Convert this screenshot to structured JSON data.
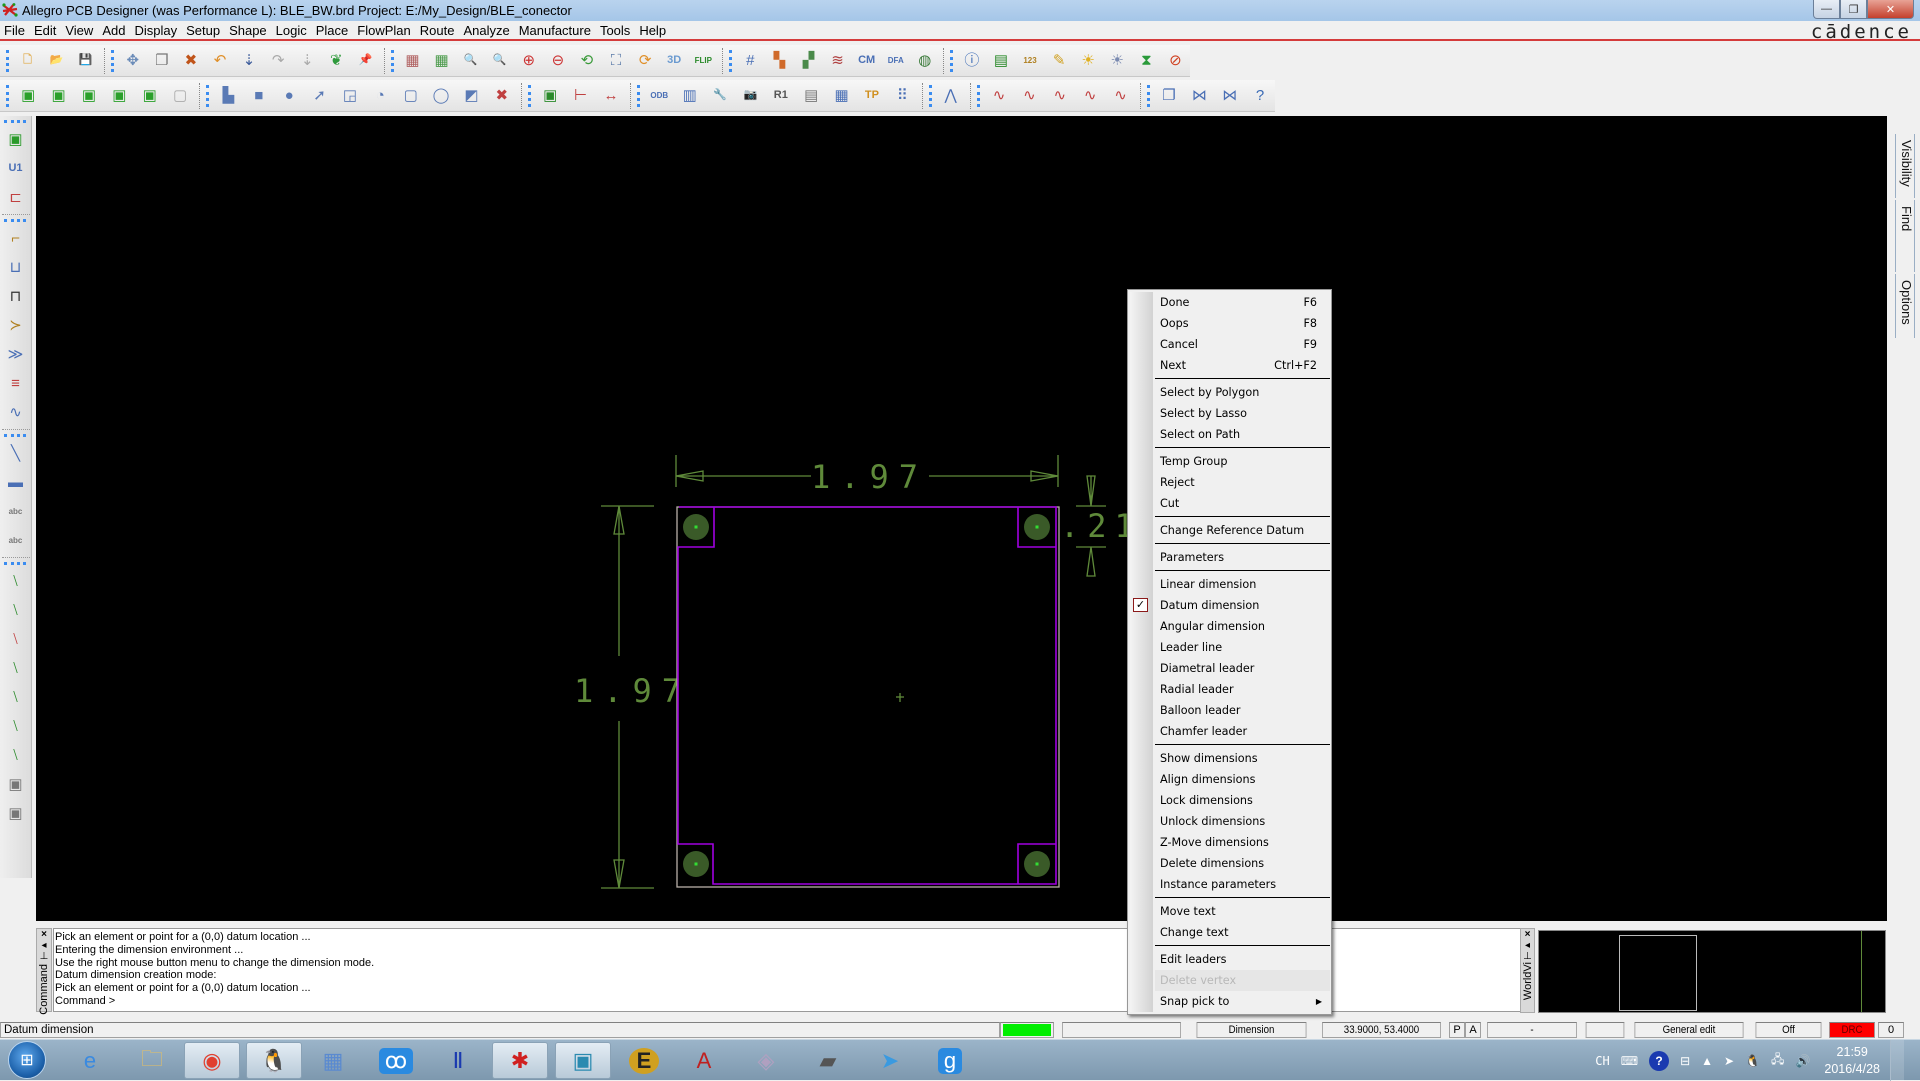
{
  "window": {
    "title": "Allegro PCB Designer (was Performance L): BLE_BW.brd  Project: E:/My_Design/BLE_conector",
    "app_icon": "allegro-icon",
    "buttons": {
      "minimize": "—",
      "restore": "❐",
      "close": "✕"
    }
  },
  "menubar": {
    "items": [
      "File",
      "Edit",
      "View",
      "Add",
      "Display",
      "Setup",
      "Shape",
      "Logic",
      "Place",
      "FlowPlan",
      "Route",
      "Analyze",
      "Manufacture",
      "Tools",
      "Help"
    ],
    "brand": "cādence"
  },
  "toolbar1": {
    "groups": [
      [
        {
          "icon": "new-file-icon",
          "glyph": "🗋",
          "color": "#e2b25c"
        },
        {
          "icon": "open-folder-icon",
          "glyph": "📂",
          "color": "#d9a948"
        },
        {
          "icon": "save-icon",
          "glyph": "💾",
          "color": "#4a6fb5"
        }
      ],
      [
        {
          "icon": "move-icon",
          "glyph": "✥",
          "color": "#6a8bb8"
        },
        {
          "icon": "copy-icon",
          "glyph": "❐",
          "color": "#777"
        },
        {
          "icon": "delete-icon",
          "glyph": "✖",
          "color": "#c0541a"
        },
        {
          "icon": "undo-icon",
          "glyph": "↶",
          "color": "#e0902a"
        },
        {
          "icon": "undo-down-icon",
          "glyph": "⇣",
          "color": "#3a5a9a"
        },
        {
          "icon": "redo-icon",
          "glyph": "↷",
          "color": "#aaa"
        },
        {
          "icon": "redo-down-icon",
          "glyph": "⇣",
          "color": "#aaa"
        },
        {
          "icon": "leaf-icon",
          "glyph": "❦",
          "color": "#2f9a3c"
        },
        {
          "icon": "pin-icon",
          "glyph": "📌",
          "color": "#2fa13c"
        }
      ],
      [
        {
          "icon": "unrats-icon",
          "glyph": "▦",
          "color": "#b06060"
        },
        {
          "icon": "rats-icon",
          "glyph": "▦",
          "color": "#4a9a4a"
        },
        {
          "icon": "zoom-fit-icon",
          "glyph": "🔍",
          "color": "#5577aa"
        },
        {
          "icon": "zoom-window-icon",
          "glyph": "🔍",
          "color": "#b05050"
        },
        {
          "icon": "zoom-in-icon",
          "glyph": "⊕",
          "color": "#c33"
        },
        {
          "icon": "zoom-out-icon",
          "glyph": "⊖",
          "color": "#c33"
        },
        {
          "icon": "zoom-previous-icon",
          "glyph": "⟲",
          "color": "#3a9a3a"
        },
        {
          "icon": "zoom-world-icon",
          "glyph": "⛶",
          "color": "#5a7aa8"
        },
        {
          "icon": "redraw-icon",
          "glyph": "⟳",
          "color": "#e0902a"
        },
        {
          "icon": "3d-view-icon",
          "glyph": "3D",
          "color": "#6a9ad0"
        },
        {
          "icon": "flip-board-icon",
          "glyph": "FLIP",
          "color": "#2a8a2a"
        }
      ],
      [
        {
          "icon": "grid-icon",
          "glyph": "#",
          "color": "#4a6fb5"
        },
        {
          "icon": "color-icon",
          "glyph": "▚",
          "color": "#d06a2a"
        },
        {
          "icon": "visibility-icon",
          "glyph": "▞",
          "color": "#4a8a4a"
        },
        {
          "icon": "layers-icon",
          "glyph": "≋",
          "color": "#b04040"
        },
        {
          "icon": "constraint-manager-icon",
          "glyph": "CM",
          "color": "#4a6fb5"
        },
        {
          "icon": "dfa-icon",
          "glyph": "DFA",
          "color": "#4a6fb5"
        },
        {
          "icon": "globe-icon",
          "glyph": "◍",
          "color": "#3a7a3a"
        }
      ],
      [
        {
          "icon": "info-icon",
          "glyph": "ⓘ",
          "color": "#3a6ab5"
        },
        {
          "icon": "report-icon",
          "glyph": "▤",
          "color": "#2a8a2a"
        },
        {
          "icon": "measure-icon",
          "glyph": "123",
          "color": "#b08020"
        },
        {
          "icon": "highlight-icon",
          "glyph": "✎",
          "color": "#d0a020"
        },
        {
          "icon": "shadow-icon",
          "glyph": "☀",
          "color": "#e0b020"
        },
        {
          "icon": "dehighlight-icon",
          "glyph": "☀",
          "color": "#7a8ab0"
        },
        {
          "icon": "hourglass-icon",
          "glyph": "⧗",
          "color": "#2a9a3a"
        },
        {
          "icon": "drc-icon",
          "glyph": "⊘",
          "color": "#d04020"
        }
      ]
    ]
  },
  "toolbar2": {
    "groups": [
      [
        {
          "icon": "etch-edit-icon",
          "glyph": "▣",
          "color": "#2aa02a"
        },
        {
          "icon": "placement-edit-icon",
          "glyph": "▣",
          "color": "#2aa02a"
        },
        {
          "icon": "general-edit-icon",
          "glyph": "▣",
          "color": "#2aa02a"
        },
        {
          "icon": "flow-plan-icon",
          "glyph": "▣",
          "color": "#2aa02a"
        },
        {
          "icon": "signal-integrity-icon",
          "glyph": "▣",
          "color": "#2aa02a"
        },
        {
          "icon": "disabled-mode-icon",
          "glyph": "▢",
          "color": "#aaa"
        }
      ],
      [
        {
          "icon": "shape-polygon-icon",
          "glyph": "▙",
          "color": "#5a7ab5"
        },
        {
          "icon": "shape-rect-icon",
          "glyph": "■",
          "color": "#5a7ab5"
        },
        {
          "icon": "shape-circle-icon",
          "glyph": "●",
          "color": "#5a7ab5"
        },
        {
          "icon": "select-shape-icon",
          "glyph": "➚",
          "color": "#5a7ab5"
        },
        {
          "icon": "manual-void-icon",
          "glyph": "◲",
          "color": "#5a7ab5"
        },
        {
          "icon": "edit-boundary-icon",
          "glyph": "◔",
          "color": "#5a7ab5"
        },
        {
          "icon": "void-rect-icon",
          "glyph": "▢",
          "color": "#5a7ab5"
        },
        {
          "icon": "void-circle-icon",
          "glyph": "◯",
          "color": "#5a7ab5"
        },
        {
          "icon": "merge-shapes-icon",
          "glyph": "◩",
          "color": "#5a7ab5"
        },
        {
          "icon": "delete-island-icon",
          "glyph": "✖",
          "color": "#c04040"
        }
      ],
      [
        {
          "icon": "component-icon",
          "glyph": "▣",
          "color": "#2a8a2a"
        },
        {
          "icon": "dimension-datum-icon",
          "glyph": "⊢",
          "color": "#c04040"
        },
        {
          "icon": "dimension-linear-icon",
          "glyph": "↔",
          "color": "#c04040"
        }
      ],
      [
        {
          "icon": "odb-export-icon",
          "glyph": "ODB",
          "color": "#4a6fb5"
        },
        {
          "icon": "padstack-icon",
          "glyph": "▥",
          "color": "#4a6fb5"
        },
        {
          "icon": "tools-icon",
          "glyph": "🔧",
          "color": "#777"
        },
        {
          "icon": "camera-icon",
          "glyph": "📷",
          "color": "#666"
        },
        {
          "icon": "rename-icon",
          "glyph": "R1",
          "color": "#555"
        },
        {
          "icon": "list-icon",
          "glyph": "▤",
          "color": "#777"
        },
        {
          "icon": "matrix-icon",
          "glyph": "▦",
          "color": "#4a6fb5"
        },
        {
          "icon": "testpoint-icon",
          "glyph": "TP",
          "color": "#d09020"
        },
        {
          "icon": "array-icon",
          "glyph": "⠿",
          "color": "#4a6fb5"
        }
      ],
      [
        {
          "icon": "topology-icon",
          "glyph": "⋀",
          "color": "#4a6fb5"
        }
      ],
      [
        {
          "icon": "signal-report-icon",
          "glyph": "∿",
          "color": "#c04040"
        },
        {
          "icon": "signal-book-icon",
          "glyph": "∿",
          "color": "#c04040"
        },
        {
          "icon": "signal-model-icon",
          "glyph": "∿",
          "color": "#c04040"
        },
        {
          "icon": "signal-check-icon",
          "glyph": "∿",
          "color": "#c04040"
        },
        {
          "icon": "signal-probe-icon",
          "glyph": "∿",
          "color": "#c04040"
        }
      ],
      [
        {
          "icon": "windows-icon",
          "glyph": "❐",
          "color": "#4a6fb5"
        },
        {
          "icon": "bookmark-icon",
          "glyph": "⋈",
          "color": "#4a6fb5"
        },
        {
          "icon": "window-icon",
          "glyph": "⋈",
          "color": "#4a6fb5"
        },
        {
          "icon": "help-icon",
          "glyph": "?",
          "color": "#3a6ab5"
        }
      ]
    ]
  },
  "lefttoolbar": {
    "groups": [
      [
        {
          "icon": "place-manual-icon",
          "glyph": "▣",
          "color": "#2a9a2a"
        },
        {
          "icon": "place-component-icon",
          "glyph": "U1",
          "color": "#4a6fb5"
        },
        {
          "icon": "swap-icon",
          "glyph": "⊏",
          "color": "#c04040"
        }
      ],
      [
        {
          "icon": "connect-icon",
          "glyph": "⌐",
          "color": "#b08020"
        },
        {
          "icon": "slide-icon",
          "glyph": "⊔",
          "color": "#4a6fb5"
        },
        {
          "icon": "delay-tune-icon",
          "glyph": "⊓",
          "color": "#333"
        },
        {
          "icon": "add-connect-icon",
          "glyph": "≻",
          "color": "#b08020"
        },
        {
          "icon": "custom-smooth-icon",
          "glyph": "≫",
          "color": "#4a6fb5"
        },
        {
          "icon": "bus-route-icon",
          "glyph": "≡",
          "color": "#c04040"
        },
        {
          "icon": "phase-tune-icon",
          "glyph": "∿",
          "color": "#4a6fb5"
        }
      ],
      [
        {
          "icon": "add-line-icon",
          "glyph": "╲",
          "color": "#4a6fb5"
        },
        {
          "icon": "add-rect-icon",
          "glyph": "▬",
          "color": "#4a6fb5"
        },
        {
          "icon": "add-text-icon",
          "glyph": "abc",
          "color": "#777"
        },
        {
          "icon": "edit-text-icon",
          "glyph": "abc",
          "color": "#777"
        }
      ],
      [
        {
          "icon": "flow-add-icon",
          "glyph": "⧵",
          "color": "#2a8a2a"
        },
        {
          "icon": "flow-edit-icon",
          "glyph": "⧵",
          "color": "#2a8a2a"
        },
        {
          "icon": "flow-delete-icon",
          "glyph": "⧵",
          "color": "#c04040"
        },
        {
          "icon": "flow-edit-props-icon",
          "glyph": "⧵",
          "color": "#2a8a2a"
        },
        {
          "icon": "flow-split-icon",
          "glyph": "⧵",
          "color": "#2a8a2a"
        },
        {
          "icon": "flow-report-icon",
          "glyph": "⧵",
          "color": "#2a8a2a"
        },
        {
          "icon": "flow-hide-icon",
          "glyph": "⧵",
          "color": "#2a8a2a"
        },
        {
          "icon": "flow-component-icon",
          "glyph": "▣",
          "color": "#777"
        },
        {
          "icon": "flow-component2-icon",
          "glyph": "▣",
          "color": "#777"
        }
      ]
    ]
  },
  "canvas": {
    "colors": {
      "dimension": "#5f8a3a",
      "outline": "#a000e0",
      "pad": "#3a5a28",
      "pad_center": "#33dd33",
      "boundary": "#b8b0a8"
    },
    "dimensions": {
      "top": "1.97",
      "left": "1.97",
      "right": ".21"
    }
  },
  "rightpanel": {
    "tabs": [
      "Visibility",
      "Find",
      "Options"
    ]
  },
  "contextmenu": {
    "groups": [
      [
        {
          "label": "Done",
          "shortcut": "F6"
        },
        {
          "label": "Oops",
          "shortcut": "F8"
        },
        {
          "label": "Cancel",
          "shortcut": "F9"
        },
        {
          "label": "Next",
          "shortcut": "Ctrl+F2"
        }
      ],
      [
        {
          "label": "Select by Polygon"
        },
        {
          "label": "Select by Lasso"
        },
        {
          "label": "Select on Path"
        }
      ],
      [
        {
          "label": "Temp Group"
        },
        {
          "label": "Reject"
        },
        {
          "label": "Cut"
        }
      ],
      [
        {
          "label": "Change Reference Datum"
        }
      ],
      [
        {
          "label": "Parameters"
        }
      ],
      [
        {
          "label": "Linear dimension"
        },
        {
          "label": "Datum dimension",
          "checked": true
        },
        {
          "label": "Angular dimension"
        },
        {
          "label": "Leader line"
        },
        {
          "label": "Diametral leader"
        },
        {
          "label": "Radial leader"
        },
        {
          "label": "Balloon leader"
        },
        {
          "label": "Chamfer leader"
        }
      ],
      [
        {
          "label": "Show dimensions"
        },
        {
          "label": "Align dimensions"
        },
        {
          "label": "Lock dimensions"
        },
        {
          "label": "Unlock dimensions"
        },
        {
          "label": "Z-Move dimensions"
        },
        {
          "label": "Delete dimensions"
        },
        {
          "label": "Instance parameters"
        }
      ],
      [
        {
          "label": "Move text"
        },
        {
          "label": "Change text"
        }
      ],
      [
        {
          "label": "Edit leaders"
        },
        {
          "label": "Delete vertex",
          "disabled": true
        },
        {
          "label": "Snap pick to",
          "submenu": true
        }
      ]
    ]
  },
  "command": {
    "panel_label": "Command",
    "lines": [
      "Pick an element or point for a (0,0) datum location ...",
      "Entering the dimension environment ...",
      "Use the right mouse button menu to change the dimension mode.",
      "Datum dimension creation mode:",
      "Pick an element or point for a (0,0) datum location ...",
      "Command >"
    ]
  },
  "worldview": {
    "panel_label": "WorldVi"
  },
  "statusbar": {
    "message": "Datum dimension",
    "indicator_color": "#00ee00",
    "mode_label": "Dimension",
    "coordinates": "33.9000, 53.4000",
    "p_button": "P",
    "a_button": "A",
    "dash": "-",
    "edit_mode": "General edit",
    "drc_state": "Off",
    "drc_label": "DRC",
    "drc_color": "#ff0000",
    "drc_count": "0"
  },
  "taskbar": {
    "apps": [
      {
        "name": "internet-explorer-icon",
        "glyph": "e",
        "color": "#3a8ae0"
      },
      {
        "name": "file-explorer-icon",
        "glyph": "🗀",
        "color": "#e8c060"
      },
      {
        "name": "chrome-icon",
        "glyph": "◉",
        "color": "#e04030"
      },
      {
        "name": "qq-icon",
        "glyph": "🐧",
        "color": "#222"
      },
      {
        "name": "calculator-icon",
        "glyph": "▦",
        "color": "#5a8ad0"
      },
      {
        "name": "baidu-cloud-icon",
        "glyph": "ꝏ",
        "color": "#fff"
      },
      {
        "name": "altium-icon",
        "glyph": "Ⅱ",
        "color": "#1a3ab0"
      },
      {
        "name": "allegro-icon",
        "glyph": "✱",
        "color": "#d02020"
      },
      {
        "name": "pad-designer-icon",
        "glyph": "▣",
        "color": "#2a8ab0"
      },
      {
        "name": "ultraedit-icon",
        "glyph": "E",
        "color": "#d0a020"
      },
      {
        "name": "acrobat-icon",
        "glyph": "A",
        "color": "#c02020"
      },
      {
        "name": "package-icon",
        "glyph": "◈",
        "color": "#b0a0c0"
      },
      {
        "name": "book-icon",
        "glyph": "▰",
        "color": "#555"
      },
      {
        "name": "telegram-icon",
        "glyph": "➤",
        "color": "#3a9ae0"
      },
      {
        "name": "app-blue-icon",
        "glyph": "g",
        "color": "#fff"
      }
    ],
    "tray": {
      "ime": "CH",
      "time": "21:59",
      "date": "2016/4/28"
    }
  }
}
